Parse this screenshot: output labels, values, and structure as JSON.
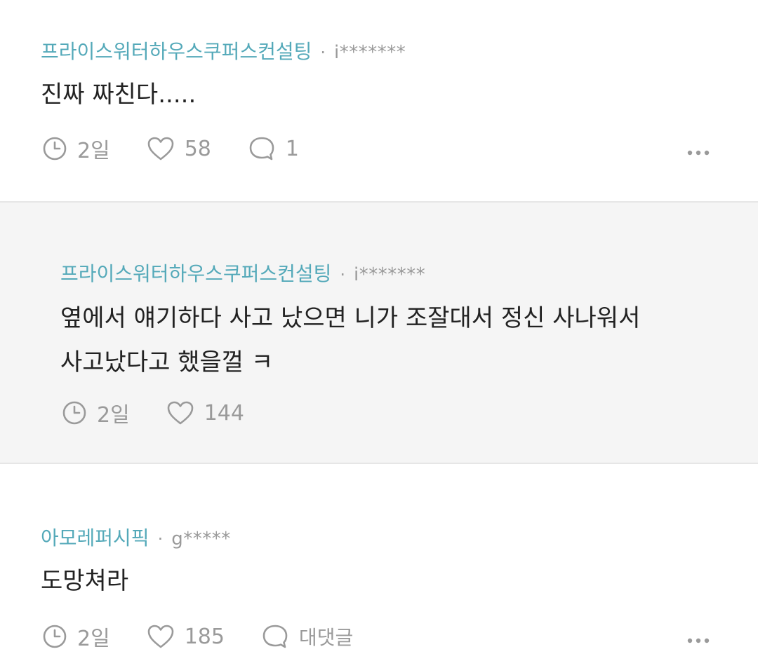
{
  "comments": [
    {
      "company": "프라이스워터하우스쿠퍼스컨설팅",
      "separator": "·",
      "user": "i*******",
      "text": "진짜 짜친다.....",
      "time": "2일",
      "likes": "58",
      "replies": "1"
    },
    {
      "company": "프라이스워터하우스쿠퍼스컨설팅",
      "separator": "·",
      "user": "i*******",
      "text_line1": "옆에서 얘기하다 사고 났으면 니가 조잘대서 정신 사나워서",
      "text_line2": "사고났다고 했을껄 ㅋ",
      "time": "2일",
      "likes": "144"
    },
    {
      "company": "아모레퍼시픽",
      "separator": "·",
      "user": "g*****",
      "text": "도망쳐라",
      "time": "2일",
      "likes": "185",
      "reply_label": "대댓글"
    }
  ],
  "icons": {
    "clock": "clock-icon",
    "heart": "heart-icon",
    "comment": "comment-icon",
    "more": "more-icon"
  },
  "colors": {
    "company": "#54a9b9",
    "meta": "#9a9a9a",
    "text": "#222222",
    "reply_bg": "#f5f5f5"
  }
}
